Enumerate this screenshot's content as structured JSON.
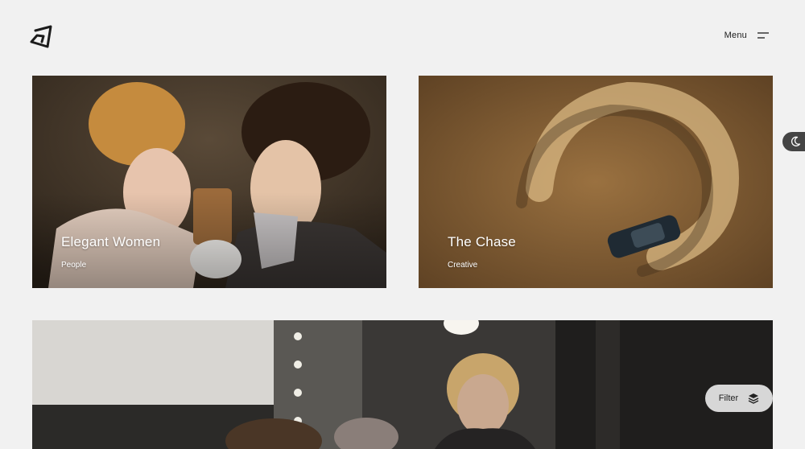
{
  "header": {
    "menu_label": "Menu"
  },
  "projects": [
    {
      "title": "Elegant Women",
      "category": "People"
    },
    {
      "title": "The Chase",
      "category": "Creative"
    },
    {
      "title": "",
      "category": ""
    }
  ],
  "filter": {
    "label": "Filter"
  },
  "icons": {
    "logo": "brand-logo-icon",
    "menu": "hamburger-menu-icon",
    "theme": "moon-icon",
    "filter": "layers-icon"
  },
  "colors": {
    "background": "#f1f1f1",
    "text": "#1c1c1c",
    "toggle": "#444444"
  }
}
